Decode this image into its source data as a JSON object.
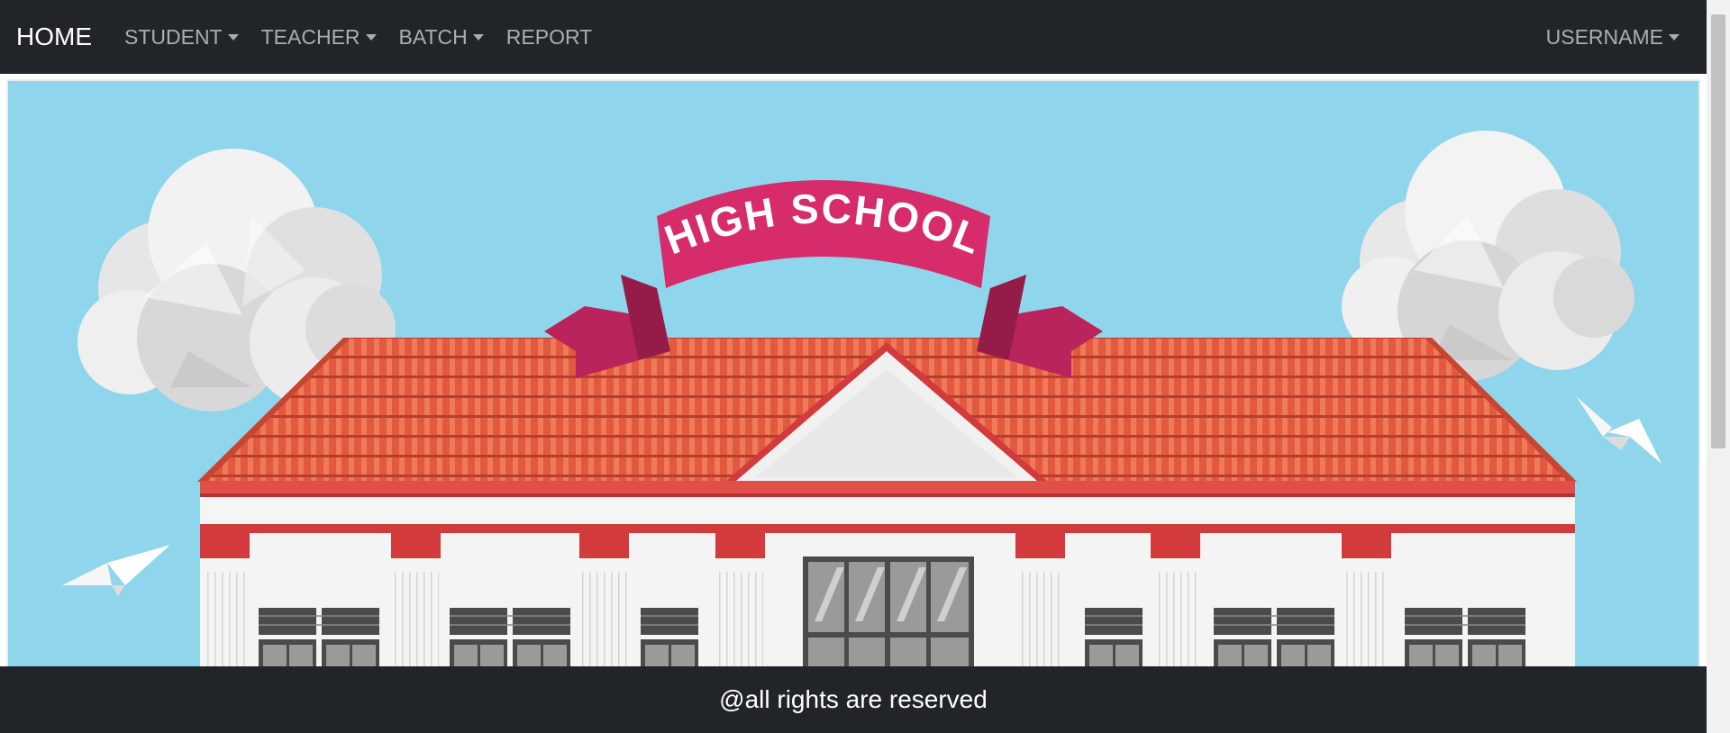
{
  "navbar": {
    "brand": "HOME",
    "items": [
      {
        "label": "STUDENT",
        "dropdown": true
      },
      {
        "label": "TEACHER",
        "dropdown": true
      },
      {
        "label": "BATCH",
        "dropdown": true
      },
      {
        "label": "REPORT",
        "dropdown": false
      }
    ],
    "user": {
      "label": "USERNAME",
      "dropdown": true
    }
  },
  "hero": {
    "banner_text": "HIGH SCHOOL"
  },
  "footer": {
    "text": "@all rights are reserved"
  },
  "colors": {
    "navbar_bg": "#212529",
    "sky": "#8fd5ec",
    "roof": "#e2593f",
    "ribbon": "#d62c6c",
    "building_trim": "#d23a3c",
    "building_wall": "#f4f4f4"
  }
}
